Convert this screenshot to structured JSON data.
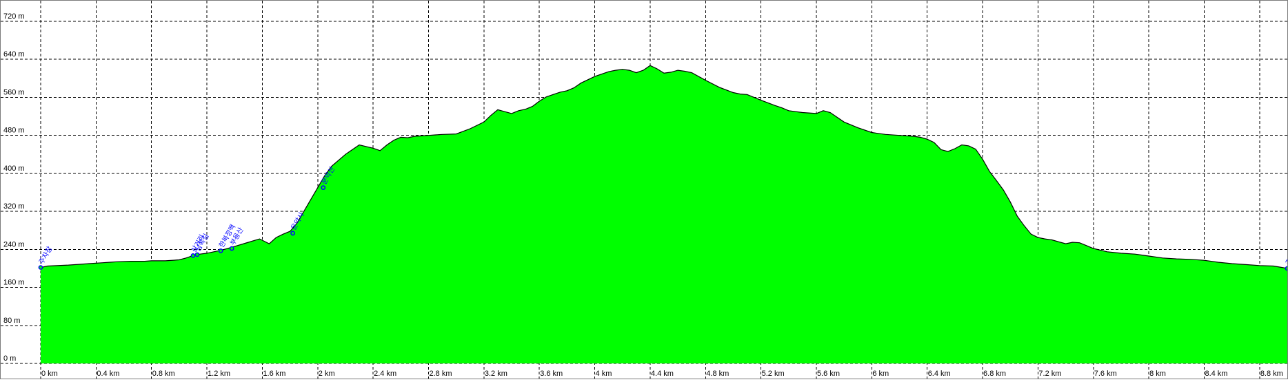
{
  "chart_data": {
    "type": "area",
    "xlabel": "",
    "ylabel": "",
    "xlim": [
      0,
      9.0
    ],
    "ylim": [
      0,
      720
    ],
    "grid": true,
    "legend": "none",
    "colors": {
      "fill": "#00ff00",
      "outline": "#000000",
      "grid": "#000000",
      "waypoint": "#0000ff",
      "background": "#ffffff"
    },
    "y_ticks": [
      {
        "value": 0,
        "label": "0 m"
      },
      {
        "value": 80,
        "label": "80 m"
      },
      {
        "value": 160,
        "label": "160 m"
      },
      {
        "value": 240,
        "label": "240 m"
      },
      {
        "value": 320,
        "label": "320 m"
      },
      {
        "value": 400,
        "label": "400 m"
      },
      {
        "value": 480,
        "label": "480 m"
      },
      {
        "value": 560,
        "label": "560 m"
      },
      {
        "value": 640,
        "label": "640 m"
      },
      {
        "value": 720,
        "label": "720 m"
      }
    ],
    "x_ticks": [
      {
        "value": 0,
        "label": "0 km"
      },
      {
        "value": 0.4,
        "label": "0.4 km"
      },
      {
        "value": 0.8,
        "label": "0.8 km"
      },
      {
        "value": 1.2,
        "label": "1.2 km"
      },
      {
        "value": 1.6,
        "label": "1.6 km"
      },
      {
        "value": 2.0,
        "label": "2 km"
      },
      {
        "value": 2.4,
        "label": "2.4 km"
      },
      {
        "value": 2.8,
        "label": "2.8 km"
      },
      {
        "value": 3.2,
        "label": "3.2 km"
      },
      {
        "value": 3.6,
        "label": "3.6 km"
      },
      {
        "value": 4.0,
        "label": "4 km"
      },
      {
        "value": 4.4,
        "label": "4.4 km"
      },
      {
        "value": 4.8,
        "label": "4.8 km"
      },
      {
        "value": 5.2,
        "label": "5.2 km"
      },
      {
        "value": 5.6,
        "label": "5.6 km"
      },
      {
        "value": 6.0,
        "label": "6 km"
      },
      {
        "value": 6.4,
        "label": "6.4 km"
      },
      {
        "value": 6.8,
        "label": "6.8 km"
      },
      {
        "value": 7.2,
        "label": "7.2 km"
      },
      {
        "value": 7.6,
        "label": "7.6 km"
      },
      {
        "value": 8.0,
        "label": "8 km"
      },
      {
        "value": 8.4,
        "label": "8.4 km"
      },
      {
        "value": 8.8,
        "label": "8.8 km"
      }
    ],
    "series": [
      {
        "x": [
          0,
          0.05,
          0.2,
          0.35,
          0.45,
          0.5,
          0.55,
          0.65,
          0.75,
          0.8,
          0.9,
          1.0,
          1.05,
          1.1,
          1.15,
          1.2,
          1.3,
          1.35,
          1.42,
          1.5,
          1.58,
          1.65,
          1.7,
          1.75,
          1.8,
          1.85,
          1.9,
          2.0,
          2.05,
          2.1,
          2.2,
          2.3,
          2.4,
          2.45,
          2.5,
          2.55,
          2.6,
          2.65,
          2.7,
          2.75,
          2.8,
          2.85,
          2.9,
          3.0,
          3.1,
          3.2,
          3.25,
          3.3,
          3.35,
          3.4,
          3.45,
          3.5,
          3.55,
          3.6,
          3.65,
          3.7,
          3.75,
          3.8,
          3.85,
          3.9,
          4.0,
          4.1,
          4.15,
          4.2,
          4.25,
          4.3,
          4.35,
          4.4,
          4.45,
          4.5,
          4.55,
          4.6,
          4.65,
          4.7,
          4.8,
          4.9,
          5.0,
          5.05,
          5.1,
          5.2,
          5.3,
          5.35,
          5.4,
          5.5,
          5.6,
          5.65,
          5.7,
          5.8,
          5.9,
          6.0,
          6.1,
          6.2,
          6.3,
          6.35,
          6.4,
          6.45,
          6.5,
          6.55,
          6.6,
          6.65,
          6.7,
          6.75,
          6.8,
          6.85,
          6.9,
          6.95,
          7.0,
          7.05,
          7.1,
          7.15,
          7.2,
          7.25,
          7.3,
          7.35,
          7.4,
          7.45,
          7.5,
          7.55,
          7.6,
          7.7,
          7.8,
          7.9,
          8.0,
          8.1,
          8.2,
          8.3,
          8.4,
          8.5,
          8.6,
          8.7,
          8.8,
          8.9,
          9.0
        ],
        "values": [
          202,
          205,
          207,
          210,
          212,
          213,
          214,
          215,
          215,
          216,
          216,
          218,
          222,
          227,
          230,
          232,
          238,
          242,
          248,
          255,
          262,
          252,
          265,
          272,
          278,
          295,
          320,
          370,
          395,
          415,
          440,
          460,
          453,
          448,
          460,
          470,
          476,
          475,
          478,
          479,
          480,
          481,
          482,
          483,
          494,
          508,
          522,
          534,
          530,
          526,
          532,
          535,
          541,
          552,
          561,
          566,
          571,
          574,
          580,
          590,
          604,
          614,
          617,
          619,
          617,
          612,
          617,
          627,
          620,
          611,
          613,
          617,
          615,
          612,
          596,
          581,
          570,
          567,
          566,
          554,
          543,
          538,
          532,
          528,
          526,
          532,
          528,
          508,
          496,
          486,
          482,
          480,
          478,
          476,
          472,
          465,
          450,
          446,
          452,
          460,
          458,
          451,
          430,
          404,
          385,
          365,
          340,
          310,
          290,
          272,
          265,
          262,
          260,
          256,
          252,
          255,
          254,
          248,
          242,
          235,
          232,
          230,
          226,
          222,
          220,
          219,
          217,
          213,
          210,
          208,
          206,
          205,
          200
        ]
      }
    ],
    "waypoints": [
      {
        "x": 0.0,
        "y": 202,
        "label": "주차장"
      },
      {
        "x": 1.1,
        "y": 227,
        "label": "삼거리"
      },
      {
        "x": 1.13,
        "y": 229,
        "label": "남쪽길"
      },
      {
        "x": 1.3,
        "y": 237,
        "label": "한북정맥"
      },
      {
        "x": 1.38,
        "y": 242,
        "label": "부용산"
      },
      {
        "x": 1.82,
        "y": 274,
        "label": "운악사"
      },
      {
        "x": 2.04,
        "y": 370,
        "label": "운악산"
      },
      {
        "x": 9.0,
        "y": 200,
        "label": "주차장"
      }
    ]
  }
}
